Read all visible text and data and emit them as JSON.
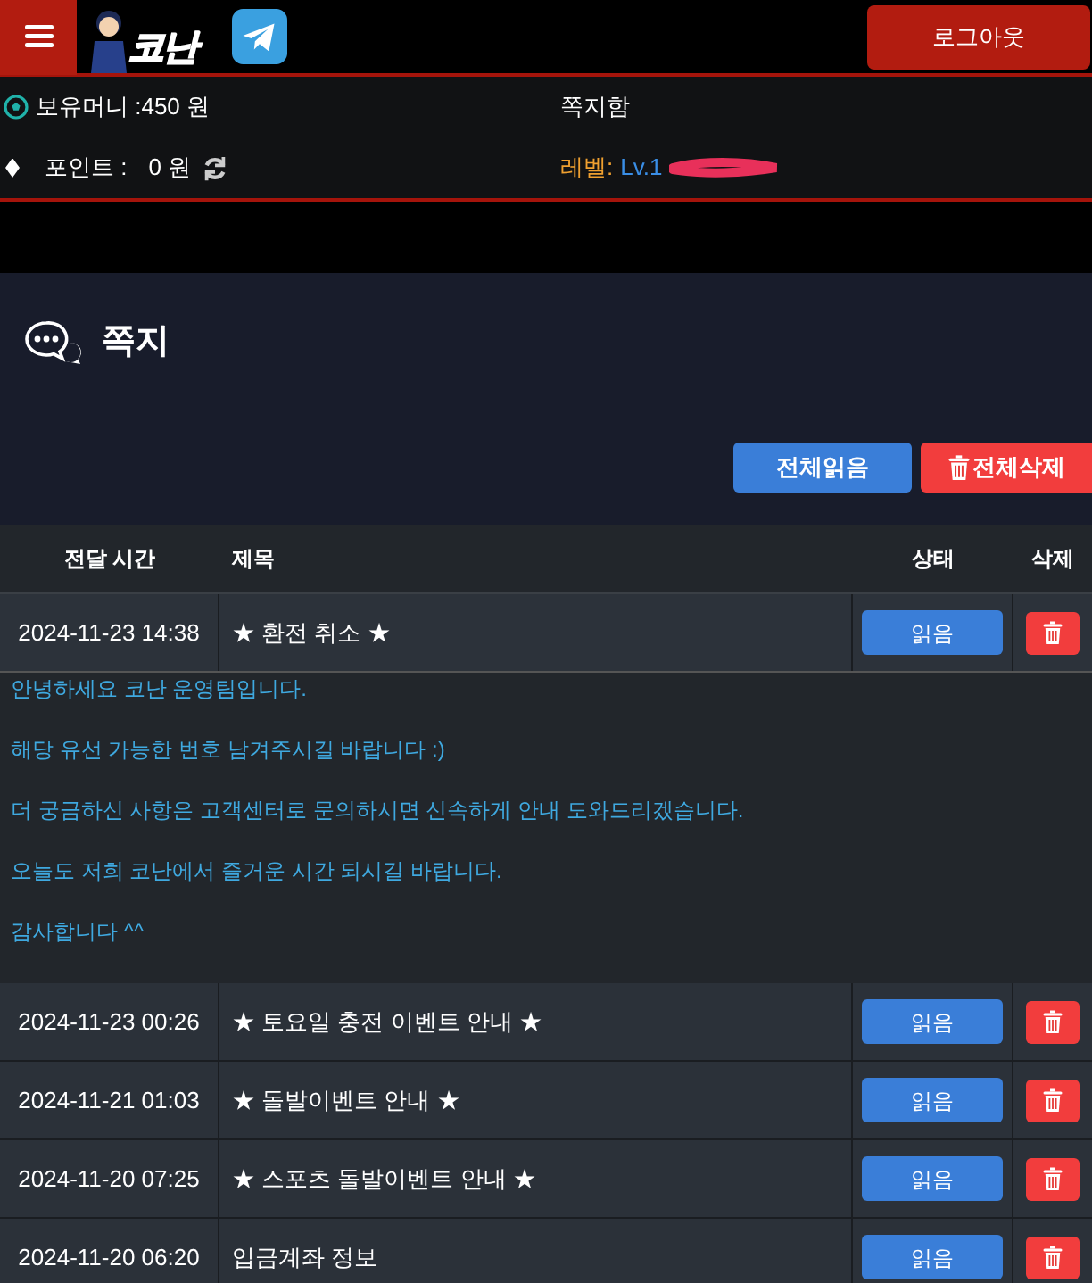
{
  "header": {
    "logo_text": "코난",
    "logout": "로그아웃"
  },
  "info": {
    "money_label": "보유머니 :450 원",
    "points_label": "포인트 :",
    "points_value": "0 원",
    "inbox_link": "쪽지함",
    "level_label": "레벨:",
    "level_value": "Lv.1"
  },
  "page": {
    "title": "쪽지",
    "buttons": [
      {
        "kind": "read",
        "label": "전체읽음"
      },
      {
        "kind": "delete",
        "label": "전체삭제"
      }
    ]
  },
  "table": {
    "columns": [
      "전달 시간",
      "제목",
      "상태",
      "삭제"
    ],
    "rows": [
      {
        "time": "2024-11-23 14:38",
        "subject": "★ 환전 취소 ★",
        "status": "읽음",
        "expanded": true,
        "body": [
          "안녕하세요 코난 운영팀입니다.",
          "해당 유선 가능한 번호 남겨주시길 바랍니다 :)",
          "더 궁금하신 사항은 고객센터로 문의하시면 신속하게 안내 도와드리겠습니다.",
          "오늘도 저희 코난에서 즐거운 시간 되시길 바랍니다.",
          "감사합니다 ^^"
        ]
      },
      {
        "time": "2024-11-23 00:26",
        "subject": "★ 토요일 충전 이벤트 안내 ★",
        "status": "읽음",
        "expanded": false
      },
      {
        "time": "2024-11-21 01:03",
        "subject": "★ 돌발이벤트 안내 ★",
        "status": "읽음",
        "expanded": false
      },
      {
        "time": "2024-11-20 07:25",
        "subject": "★ 스포츠 돌발이벤트 안내 ★",
        "status": "읽음",
        "expanded": false
      },
      {
        "time": "2024-11-20 06:20",
        "subject": "입금계좌 정보",
        "status": "읽음",
        "expanded": false
      }
    ]
  }
}
